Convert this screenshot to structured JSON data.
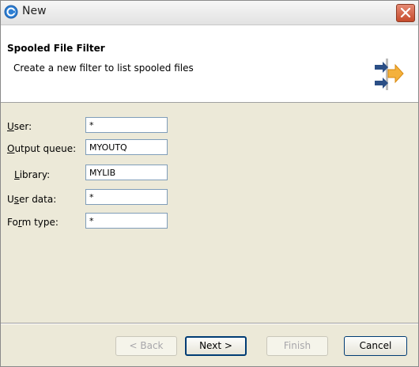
{
  "window": {
    "title": "New",
    "accent": "#2e7fd3",
    "close_icon": "close-icon"
  },
  "header": {
    "title": "Spooled File Filter",
    "description": "Create a new filter to list spooled files",
    "icon": "wizard-arrows-icon"
  },
  "form": {
    "user": {
      "label_pre": "",
      "label_u": "U",
      "label_post": "ser:",
      "value": "*"
    },
    "output_queue": {
      "label_pre": "",
      "label_u": "O",
      "label_post": "utput queue:",
      "value": "MYOUTQ"
    },
    "library": {
      "label_pre": "",
      "label_u": "L",
      "label_post": "ibrary:",
      "value": "MYLIB"
    },
    "user_data": {
      "label_pre": "U",
      "label_u": "s",
      "label_post": "er data:",
      "value": "*"
    },
    "form_type": {
      "label_pre": "Fo",
      "label_u": "r",
      "label_post": "m type:",
      "value": "*"
    }
  },
  "buttons": {
    "back": "< Back",
    "next": "Next >",
    "finish": "Finish",
    "cancel": "Cancel"
  }
}
